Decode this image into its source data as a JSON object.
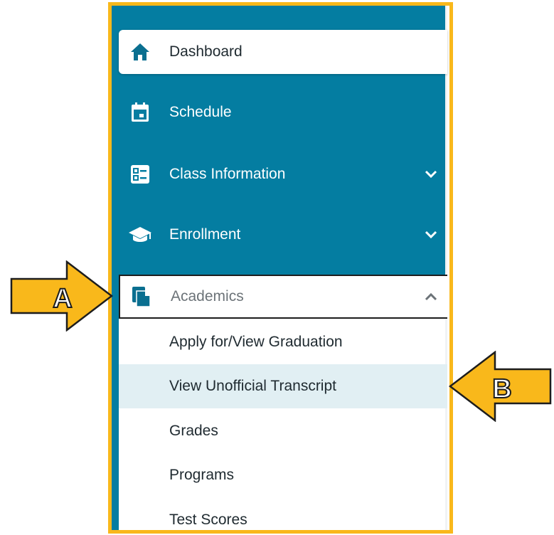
{
  "sidebar": {
    "items": [
      {
        "label": "Dashboard",
        "icon": "home-icon"
      },
      {
        "label": "Schedule",
        "icon": "calendar-icon"
      },
      {
        "label": "Class Information",
        "icon": "class-list-icon"
      },
      {
        "label": "Enrollment",
        "icon": "graduation-cap-icon"
      },
      {
        "label": "Academics",
        "icon": "documents-icon"
      }
    ],
    "academics_submenu": [
      {
        "label": "Apply for/View Graduation"
      },
      {
        "label": "View Unofficial Transcript"
      },
      {
        "label": "Grades"
      },
      {
        "label": "Programs"
      },
      {
        "label": "Test Scores"
      }
    ]
  },
  "annotations": {
    "arrow_a": "A",
    "arrow_b": "B"
  },
  "colors": {
    "sidebar_teal": "#047da1",
    "highlight_frame": "#f9b81b",
    "selected_row": "#e1eff3",
    "arrow_fill": "#f9b81b"
  }
}
